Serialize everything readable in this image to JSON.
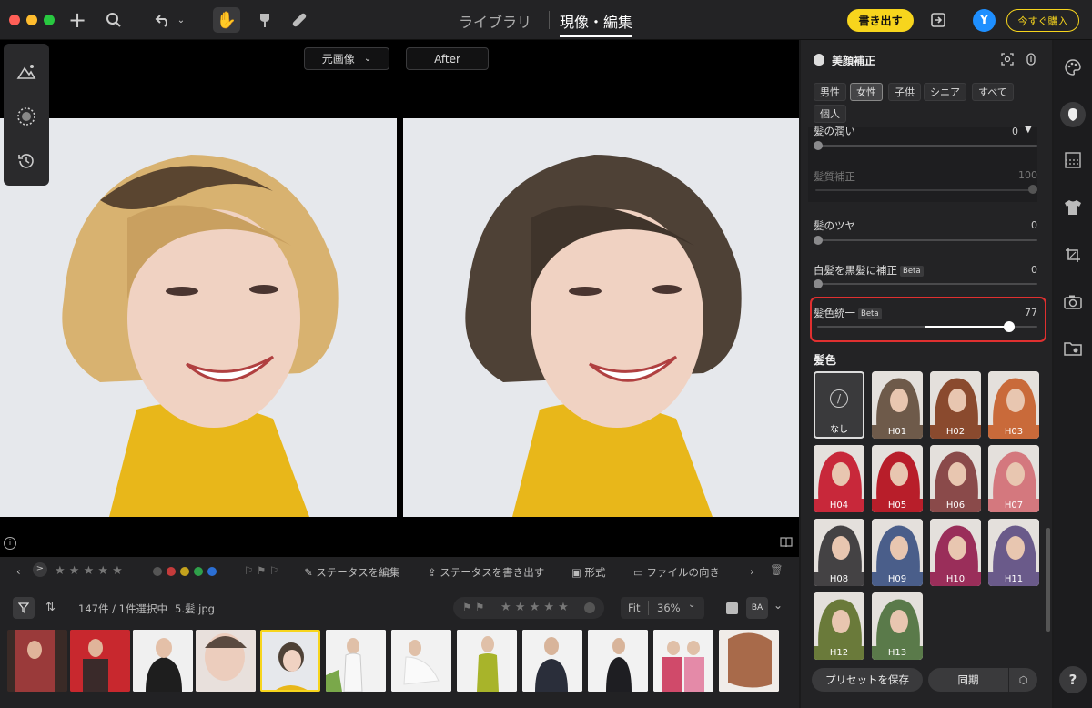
{
  "titlebar": {
    "nav_library": "ライブラリ",
    "nav_develop": "現像・編集",
    "export_label": "書き出す",
    "avatar_letter": "Y",
    "buy_label": "今すぐ購入"
  },
  "viewer": {
    "original_select": "元画像",
    "after_label": "After"
  },
  "filter_bar": {
    "edit_status": "ステータスを編集",
    "export_status": "ステータスを書き出す",
    "format": "形式",
    "orientation": "ファイルの向き"
  },
  "status_bar": {
    "count": "147件 / 1件選択中",
    "filename": "5.髪.jpg",
    "fit": "Fit",
    "zoom": "36%",
    "compare": "BA"
  },
  "panel": {
    "title": "美顔補正",
    "chips": [
      "男性",
      "女性",
      "子供",
      "シニア",
      "すべて",
      "個人"
    ],
    "sliders": [
      {
        "label": "髪の潤い",
        "value": "0",
        "level": 0
      },
      {
        "label": "髪質補正",
        "value": "100",
        "level": 1
      },
      {
        "label": "髪のツヤ",
        "value": "0",
        "level": 0
      },
      {
        "label": "白髪を黒髪に補正",
        "value": "0",
        "level": 0
      },
      {
        "label": "髪色統一",
        "value": "77",
        "level": 0.77
      }
    ],
    "beta": "Beta",
    "hair_color_title": "髪色",
    "none_label": "なし",
    "swatches": [
      "H01",
      "H02",
      "H03",
      "H04",
      "H05",
      "H06",
      "H07",
      "H08",
      "H09",
      "H10",
      "H11",
      "H12",
      "H13"
    ],
    "swatch_colors": [
      "#6e5a4a",
      "#8a4a2e",
      "#c96a3a",
      "#c8283a",
      "#b81e2a",
      "#8a4a4a",
      "#d4787e",
      "#444244",
      "#4a5e8a",
      "#9a2e5a",
      "#6a5a8a",
      "#6a7a3a",
      "#5a7a4a"
    ],
    "save_preset": "プリセットを保存",
    "sync": "同期",
    "help": "?"
  },
  "colors": {
    "accent_yellow": "#f7d51d",
    "highlight_red": "#e03030",
    "avatar_blue": "#1e8fff"
  }
}
